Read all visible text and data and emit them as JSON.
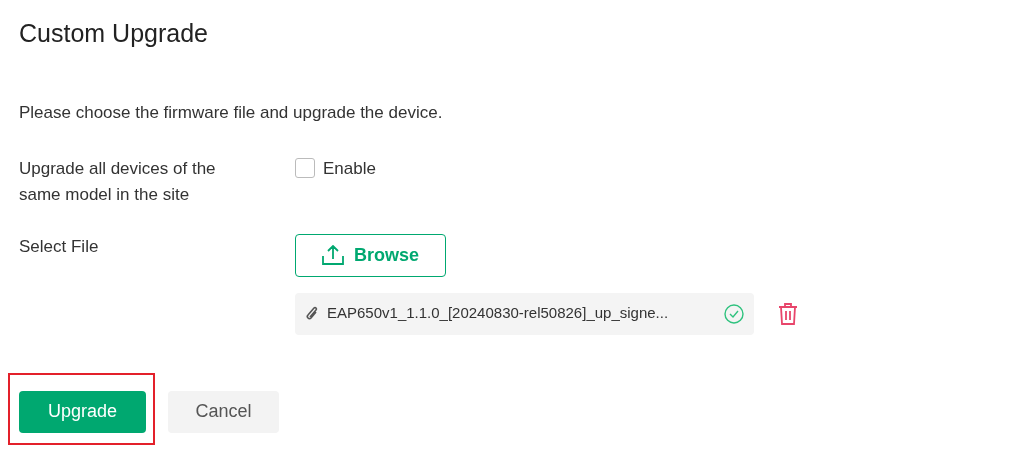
{
  "title": "Custom Upgrade",
  "description": "Please choose the firmware file and upgrade the device.",
  "fields": [
    {
      "kind": "checkbox",
      "label": "Upgrade all devices of the same model in the site",
      "option": "Enable",
      "checked": false
    },
    {
      "kind": "file",
      "label": "Select File",
      "button": "Browse",
      "file": {
        "name": "EAP650v1_1.1.0_[20240830-rel50826]_up_signe...",
        "uploaded": true
      }
    }
  ],
  "buttons": [
    {
      "label": "Upgrade",
      "kind": "primary",
      "highlighted": true
    },
    {
      "label": "Cancel",
      "kind": "secondary",
      "highlighted": false
    }
  ]
}
